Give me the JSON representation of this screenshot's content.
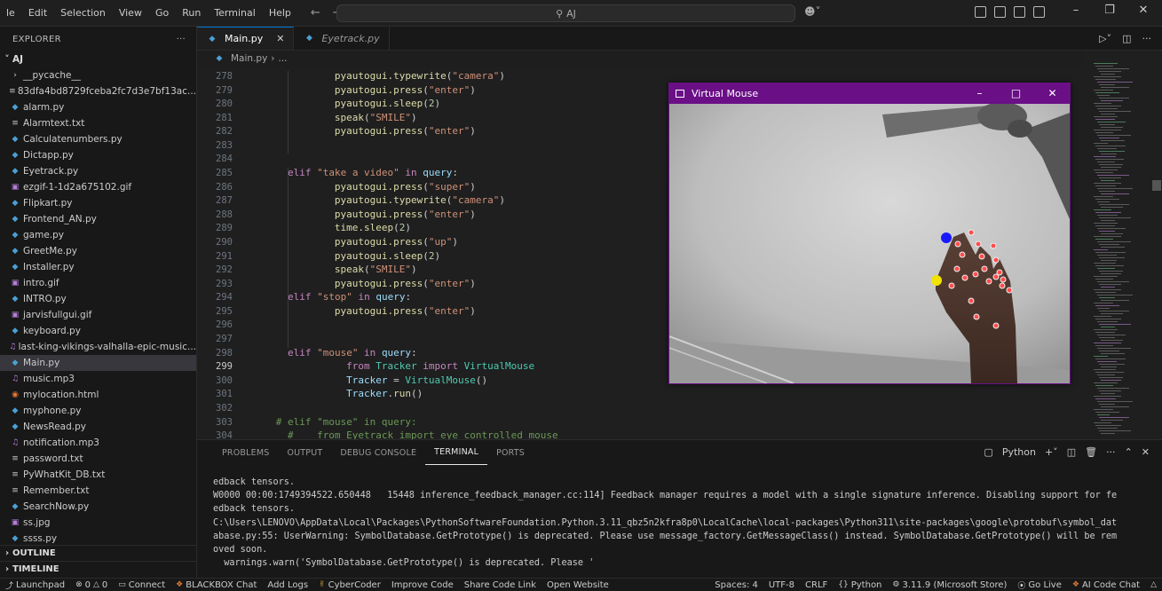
{
  "menu": [
    "le",
    "Edit",
    "Selection",
    "View",
    "Go",
    "Run",
    "Terminal",
    "Help"
  ],
  "command_center": {
    "text": "AJ"
  },
  "sidebar": {
    "title": "EXPLORER",
    "more": "···",
    "root": "AJ",
    "files": [
      {
        "name": "__pycache__",
        "type": "dir"
      },
      {
        "name": "83dfa4bd8729fceba2fc7d3e7bf13ac...",
        "type": "hash"
      },
      {
        "name": "alarm.py",
        "type": "py"
      },
      {
        "name": "Alarmtext.txt",
        "type": "txt"
      },
      {
        "name": "Calculatenumbers.py",
        "type": "py"
      },
      {
        "name": "Dictapp.py",
        "type": "py"
      },
      {
        "name": "Eyetrack.py",
        "type": "py"
      },
      {
        "name": "ezgif-1-1d2a675102.gif",
        "type": "gif"
      },
      {
        "name": "Flipkart.py",
        "type": "py"
      },
      {
        "name": "Frontend_AN.py",
        "type": "py"
      },
      {
        "name": "game.py",
        "type": "py"
      },
      {
        "name": "GreetMe.py",
        "type": "py"
      },
      {
        "name": "Installer.py",
        "type": "py"
      },
      {
        "name": "intro.gif",
        "type": "gif"
      },
      {
        "name": "INTRO.py",
        "type": "py"
      },
      {
        "name": "jarvisfullgui.gif",
        "type": "gif"
      },
      {
        "name": "keyboard.py",
        "type": "py"
      },
      {
        "name": "last-king-vikings-valhalla-epic-music...",
        "type": "mp3"
      },
      {
        "name": "Main.py",
        "type": "py",
        "active": true
      },
      {
        "name": "music.mp3",
        "type": "mp3"
      },
      {
        "name": "mylocation.html",
        "type": "html"
      },
      {
        "name": "myphone.py",
        "type": "py"
      },
      {
        "name": "NewsRead.py",
        "type": "py"
      },
      {
        "name": "notification.mp3",
        "type": "mp3"
      },
      {
        "name": "password.txt",
        "type": "txt"
      },
      {
        "name": "PyWhatKit_DB.txt",
        "type": "txt"
      },
      {
        "name": "Remember.txt",
        "type": "txt"
      },
      {
        "name": "SearchNow.py",
        "type": "py"
      },
      {
        "name": "ss.jpg",
        "type": "jpg"
      },
      {
        "name": "ssss.py",
        "type": "py"
      }
    ],
    "outline": "OUTLINE",
    "timeline": "TIMELINE"
  },
  "tabs": [
    {
      "label": "Main.py",
      "active": true
    },
    {
      "label": "Eyetrack.py",
      "active": false
    }
  ],
  "breadcrumb": {
    "file": "Main.py",
    "rest": "..."
  },
  "editor": {
    "current_line": "299",
    "lines": [
      {
        "n": "278",
        "indent": 8,
        "tokens": [
          [
            "f",
            "pyautogui.typewrite"
          ],
          [
            "p",
            "("
          ],
          [
            "s",
            "\"camera\""
          ],
          [
            "p",
            ")"
          ]
        ]
      },
      {
        "n": "279",
        "indent": 8,
        "tokens": [
          [
            "f",
            "pyautogui.press"
          ],
          [
            "p",
            "("
          ],
          [
            "s",
            "\"enter\""
          ],
          [
            "p",
            ")"
          ]
        ]
      },
      {
        "n": "280",
        "indent": 8,
        "tokens": [
          [
            "f",
            "pyautogui.sleep"
          ],
          [
            "p",
            "("
          ],
          [
            "n",
            "2"
          ],
          [
            "p",
            ")"
          ]
        ]
      },
      {
        "n": "281",
        "indent": 8,
        "tokens": [
          [
            "f",
            "speak"
          ],
          [
            "p",
            "("
          ],
          [
            "s",
            "\"SMILE\""
          ],
          [
            "p",
            ")"
          ]
        ]
      },
      {
        "n": "282",
        "indent": 8,
        "tokens": [
          [
            "f",
            "pyautogui.press"
          ],
          [
            "p",
            "("
          ],
          [
            "s",
            "\"enter\""
          ],
          [
            "p",
            ")"
          ]
        ]
      },
      {
        "n": "283",
        "indent": 0,
        "tokens": []
      },
      {
        "n": "284",
        "indent": 0,
        "tokens": []
      },
      {
        "n": "285",
        "indent": 4,
        "tokens": [
          [
            "k",
            "elif "
          ],
          [
            "s",
            "\"take a video\""
          ],
          [
            "k",
            " in "
          ],
          [
            "v",
            "query"
          ],
          [
            "p",
            ":"
          ]
        ]
      },
      {
        "n": "286",
        "indent": 8,
        "tokens": [
          [
            "f",
            "pyautogui.press"
          ],
          [
            "p",
            "("
          ],
          [
            "s",
            "\"super\""
          ],
          [
            "p",
            ")"
          ]
        ]
      },
      {
        "n": "287",
        "indent": 8,
        "tokens": [
          [
            "f",
            "pyautogui.typewrite"
          ],
          [
            "p",
            "("
          ],
          [
            "s",
            "\"camera\""
          ],
          [
            "p",
            ")"
          ]
        ]
      },
      {
        "n": "288",
        "indent": 8,
        "tokens": [
          [
            "f",
            "pyautogui.press"
          ],
          [
            "p",
            "("
          ],
          [
            "s",
            "\"enter\""
          ],
          [
            "p",
            ")"
          ]
        ]
      },
      {
        "n": "289",
        "indent": 8,
        "tokens": [
          [
            "f",
            "time.sleep"
          ],
          [
            "p",
            "("
          ],
          [
            "n",
            "2"
          ],
          [
            "p",
            ")"
          ]
        ]
      },
      {
        "n": "290",
        "indent": 8,
        "tokens": [
          [
            "f",
            "pyautogui.press"
          ],
          [
            "p",
            "("
          ],
          [
            "s",
            "\"up\""
          ],
          [
            "p",
            ")"
          ]
        ]
      },
      {
        "n": "291",
        "indent": 8,
        "tokens": [
          [
            "f",
            "pyautogui.sleep"
          ],
          [
            "p",
            "("
          ],
          [
            "n",
            "2"
          ],
          [
            "p",
            ")"
          ]
        ]
      },
      {
        "n": "292",
        "indent": 8,
        "tokens": [
          [
            "f",
            "speak"
          ],
          [
            "p",
            "("
          ],
          [
            "s",
            "\"SMILE\""
          ],
          [
            "p",
            ")"
          ]
        ]
      },
      {
        "n": "293",
        "indent": 8,
        "tokens": [
          [
            "f",
            "pyautogui.press"
          ],
          [
            "p",
            "("
          ],
          [
            "s",
            "\"enter\""
          ],
          [
            "p",
            ")"
          ]
        ]
      },
      {
        "n": "294",
        "indent": 4,
        "tokens": [
          [
            "k",
            "elif "
          ],
          [
            "s",
            "\"stop\""
          ],
          [
            "k",
            " in "
          ],
          [
            "v",
            "query"
          ],
          [
            "p",
            ":"
          ]
        ]
      },
      {
        "n": "295",
        "indent": 8,
        "tokens": [
          [
            "f",
            "pyautogui.press"
          ],
          [
            "p",
            "("
          ],
          [
            "s",
            "\"enter\""
          ],
          [
            "p",
            ")"
          ]
        ]
      },
      {
        "n": "296",
        "indent": 0,
        "tokens": []
      },
      {
        "n": "297",
        "indent": 0,
        "tokens": []
      },
      {
        "n": "298",
        "indent": 4,
        "tokens": [
          [
            "k",
            "elif "
          ],
          [
            "s",
            "\"mouse\""
          ],
          [
            "k",
            " in "
          ],
          [
            "v",
            "query"
          ],
          [
            "p",
            ":"
          ]
        ]
      },
      {
        "n": "299",
        "indent": 9,
        "tokens": [
          [
            "k",
            "from "
          ],
          [
            "cl",
            "Tracker"
          ],
          [
            "k",
            " import "
          ],
          [
            "cl",
            "VirtualMouse"
          ]
        ]
      },
      {
        "n": "300",
        "indent": 9,
        "tokens": [
          [
            "v",
            "Tracker"
          ],
          [
            "p",
            " = "
          ],
          [
            "cl",
            "VirtualMouse"
          ],
          [
            "p",
            "()"
          ]
        ]
      },
      {
        "n": "301",
        "indent": 9,
        "tokens": [
          [
            "v",
            "Tracker"
          ],
          [
            "p",
            "."
          ],
          [
            "f",
            "run"
          ],
          [
            "p",
            "()"
          ]
        ]
      },
      {
        "n": "302",
        "indent": 0,
        "tokens": []
      },
      {
        "n": "303",
        "indent": 3,
        "tokens": [
          [
            "c",
            "# elif \"mouse\" in query:"
          ]
        ]
      },
      {
        "n": "304",
        "indent": 4,
        "tokens": [
          [
            "c",
            "#    from Eyetrack import eye_controlled_mouse"
          ]
        ]
      }
    ]
  },
  "virtual_mouse": {
    "title": "Virtual Mouse"
  },
  "panel": {
    "tabs": [
      {
        "label": "PROBLEMS"
      },
      {
        "label": "OUTPUT"
      },
      {
        "label": "DEBUG CONSOLE"
      },
      {
        "label": "TERMINAL",
        "active": true
      },
      {
        "label": "PORTS"
      }
    ],
    "shell": "Python",
    "terminal": [
      "edback tensors.",
      "W0000 00:00:1749394522.650448   15448 inference_feedback_manager.cc:114] Feedback manager requires a model with a single signature inference. Disabling support for fe",
      "edback tensors.",
      "C:\\Users\\LENOVO\\AppData\\Local\\Packages\\PythonSoftwareFoundation.Python.3.11_qbz5n2kfra8p0\\LocalCache\\local-packages\\Python311\\site-packages\\google\\protobuf\\symbol_dat",
      "abase.py:55: UserWarning: SymbolDatabase.GetPrototype() is deprecated. Please use message_factory.GetMessageClass() instead. SymbolDatabase.GetPrototype() will be rem",
      "oved soon.",
      "  warnings.warn('SymbolDatabase.GetPrototype() is deprecated. Please '"
    ]
  },
  "status": {
    "launchpad": "Launchpad",
    "errors": "0",
    "warnings": "0",
    "connect": "Connect",
    "blackbox": "BLACKBOX Chat",
    "add_logs": "Add Logs",
    "cybercoder": "CyberCoder",
    "improve_code": "Improve Code",
    "share_code": "Share Code Link",
    "open_website": "Open Website",
    "spaces": "Spaces: 4",
    "encoding": "UTF-8",
    "eol": "CRLF",
    "language": "Python",
    "interpreter": "3.11.9 (Microsoft Store)",
    "go_live": "Go Live",
    "ai_chat": "AI Code Chat"
  }
}
